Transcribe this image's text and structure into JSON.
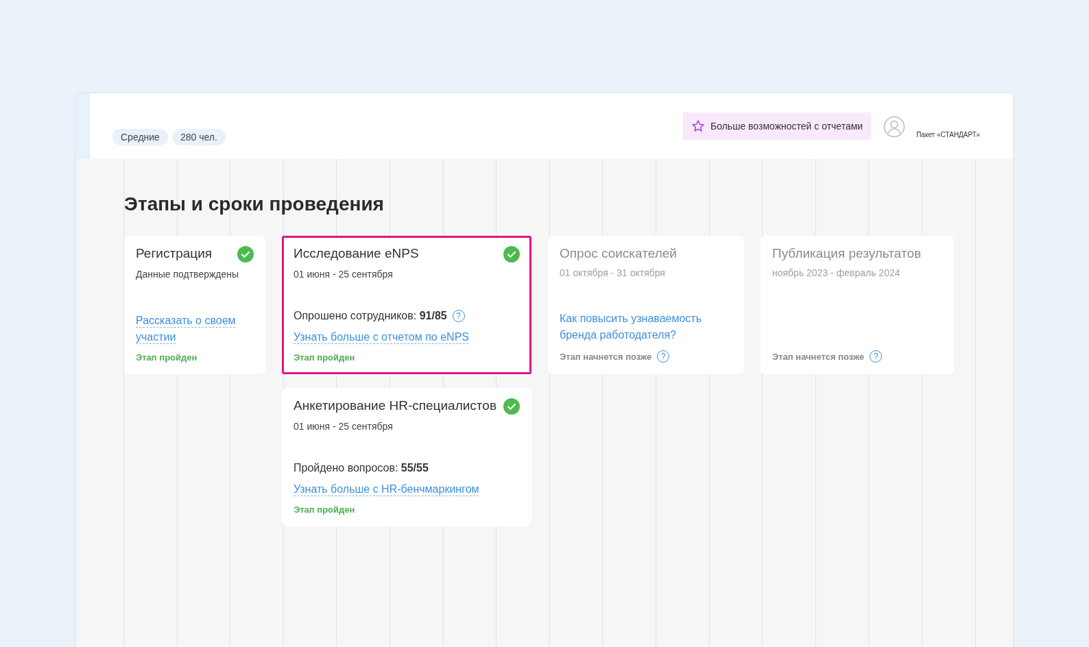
{
  "header": {
    "chips": [
      "Средние",
      "280 чел."
    ],
    "promo_button": "Больше возможностей с отчетами",
    "plan": "Пакет «СТАНДАРТ»"
  },
  "heading": "Этапы и сроки проведения",
  "columns": [
    {
      "cards": [
        {
          "title": "Регистрация",
          "kind": "done",
          "selected": false,
          "subtitle": "Данные подтверждены",
          "link": "Рассказать о своем участии",
          "status": "Этап пройден"
        }
      ]
    },
    {
      "cards": [
        {
          "title": "Исследование eNPS",
          "kind": "done",
          "selected": true,
          "subtitle": "01 июня - 25 сентября",
          "metric_label": "Опрошено сотрудников:",
          "metric_value": "91/85",
          "metric_help": "?",
          "link": "Узнать больше с отчетом по eNPS",
          "status": "Этап пройден"
        },
        {
          "title": "Анкетирование HR-специалистов",
          "kind": "done",
          "selected": false,
          "subtitle": "01 июня - 25 сентября",
          "metric_label": "Пройдено вопросов:",
          "metric_value": "55/55",
          "link": "Узнать больше с HR-бенчмаркингом",
          "status": "Этап пройден"
        }
      ]
    },
    {
      "cards": [
        {
          "title": "Опрос соискателей",
          "kind": "upcoming",
          "selected": false,
          "subtitle": "01 октября - 31 октября",
          "link": "Как повысить узнаваемость бренда работодателя?",
          "status": "Этап начнется позже",
          "status_help": "?"
        }
      ]
    },
    {
      "cards": [
        {
          "title": "Публикация результатов",
          "kind": "upcoming",
          "selected": false,
          "subtitle": "ноябрь 2023 - февраль 2024",
          "status": "Этап начнется позже",
          "status_help": "?"
        }
      ]
    }
  ]
}
